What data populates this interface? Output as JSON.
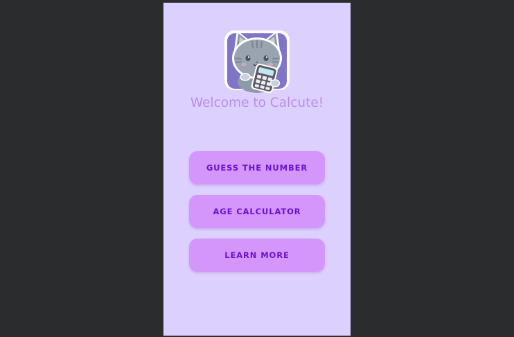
{
  "app": {
    "welcome_text": "Welcome to Calcute!",
    "logo_icon": "cat-with-calculator-icon"
  },
  "buttons": {
    "guess_label": "GUESS THE NUMBER",
    "age_label": "AGE CALCULATOR",
    "learn_label": "LEARN MORE"
  },
  "colors": {
    "outer_background": "#2b2c2e",
    "screen_background": "#dcd0ff",
    "welcome_text": "#b98ee8",
    "button_background": "#d596fb",
    "button_text": "#6a12cf"
  }
}
